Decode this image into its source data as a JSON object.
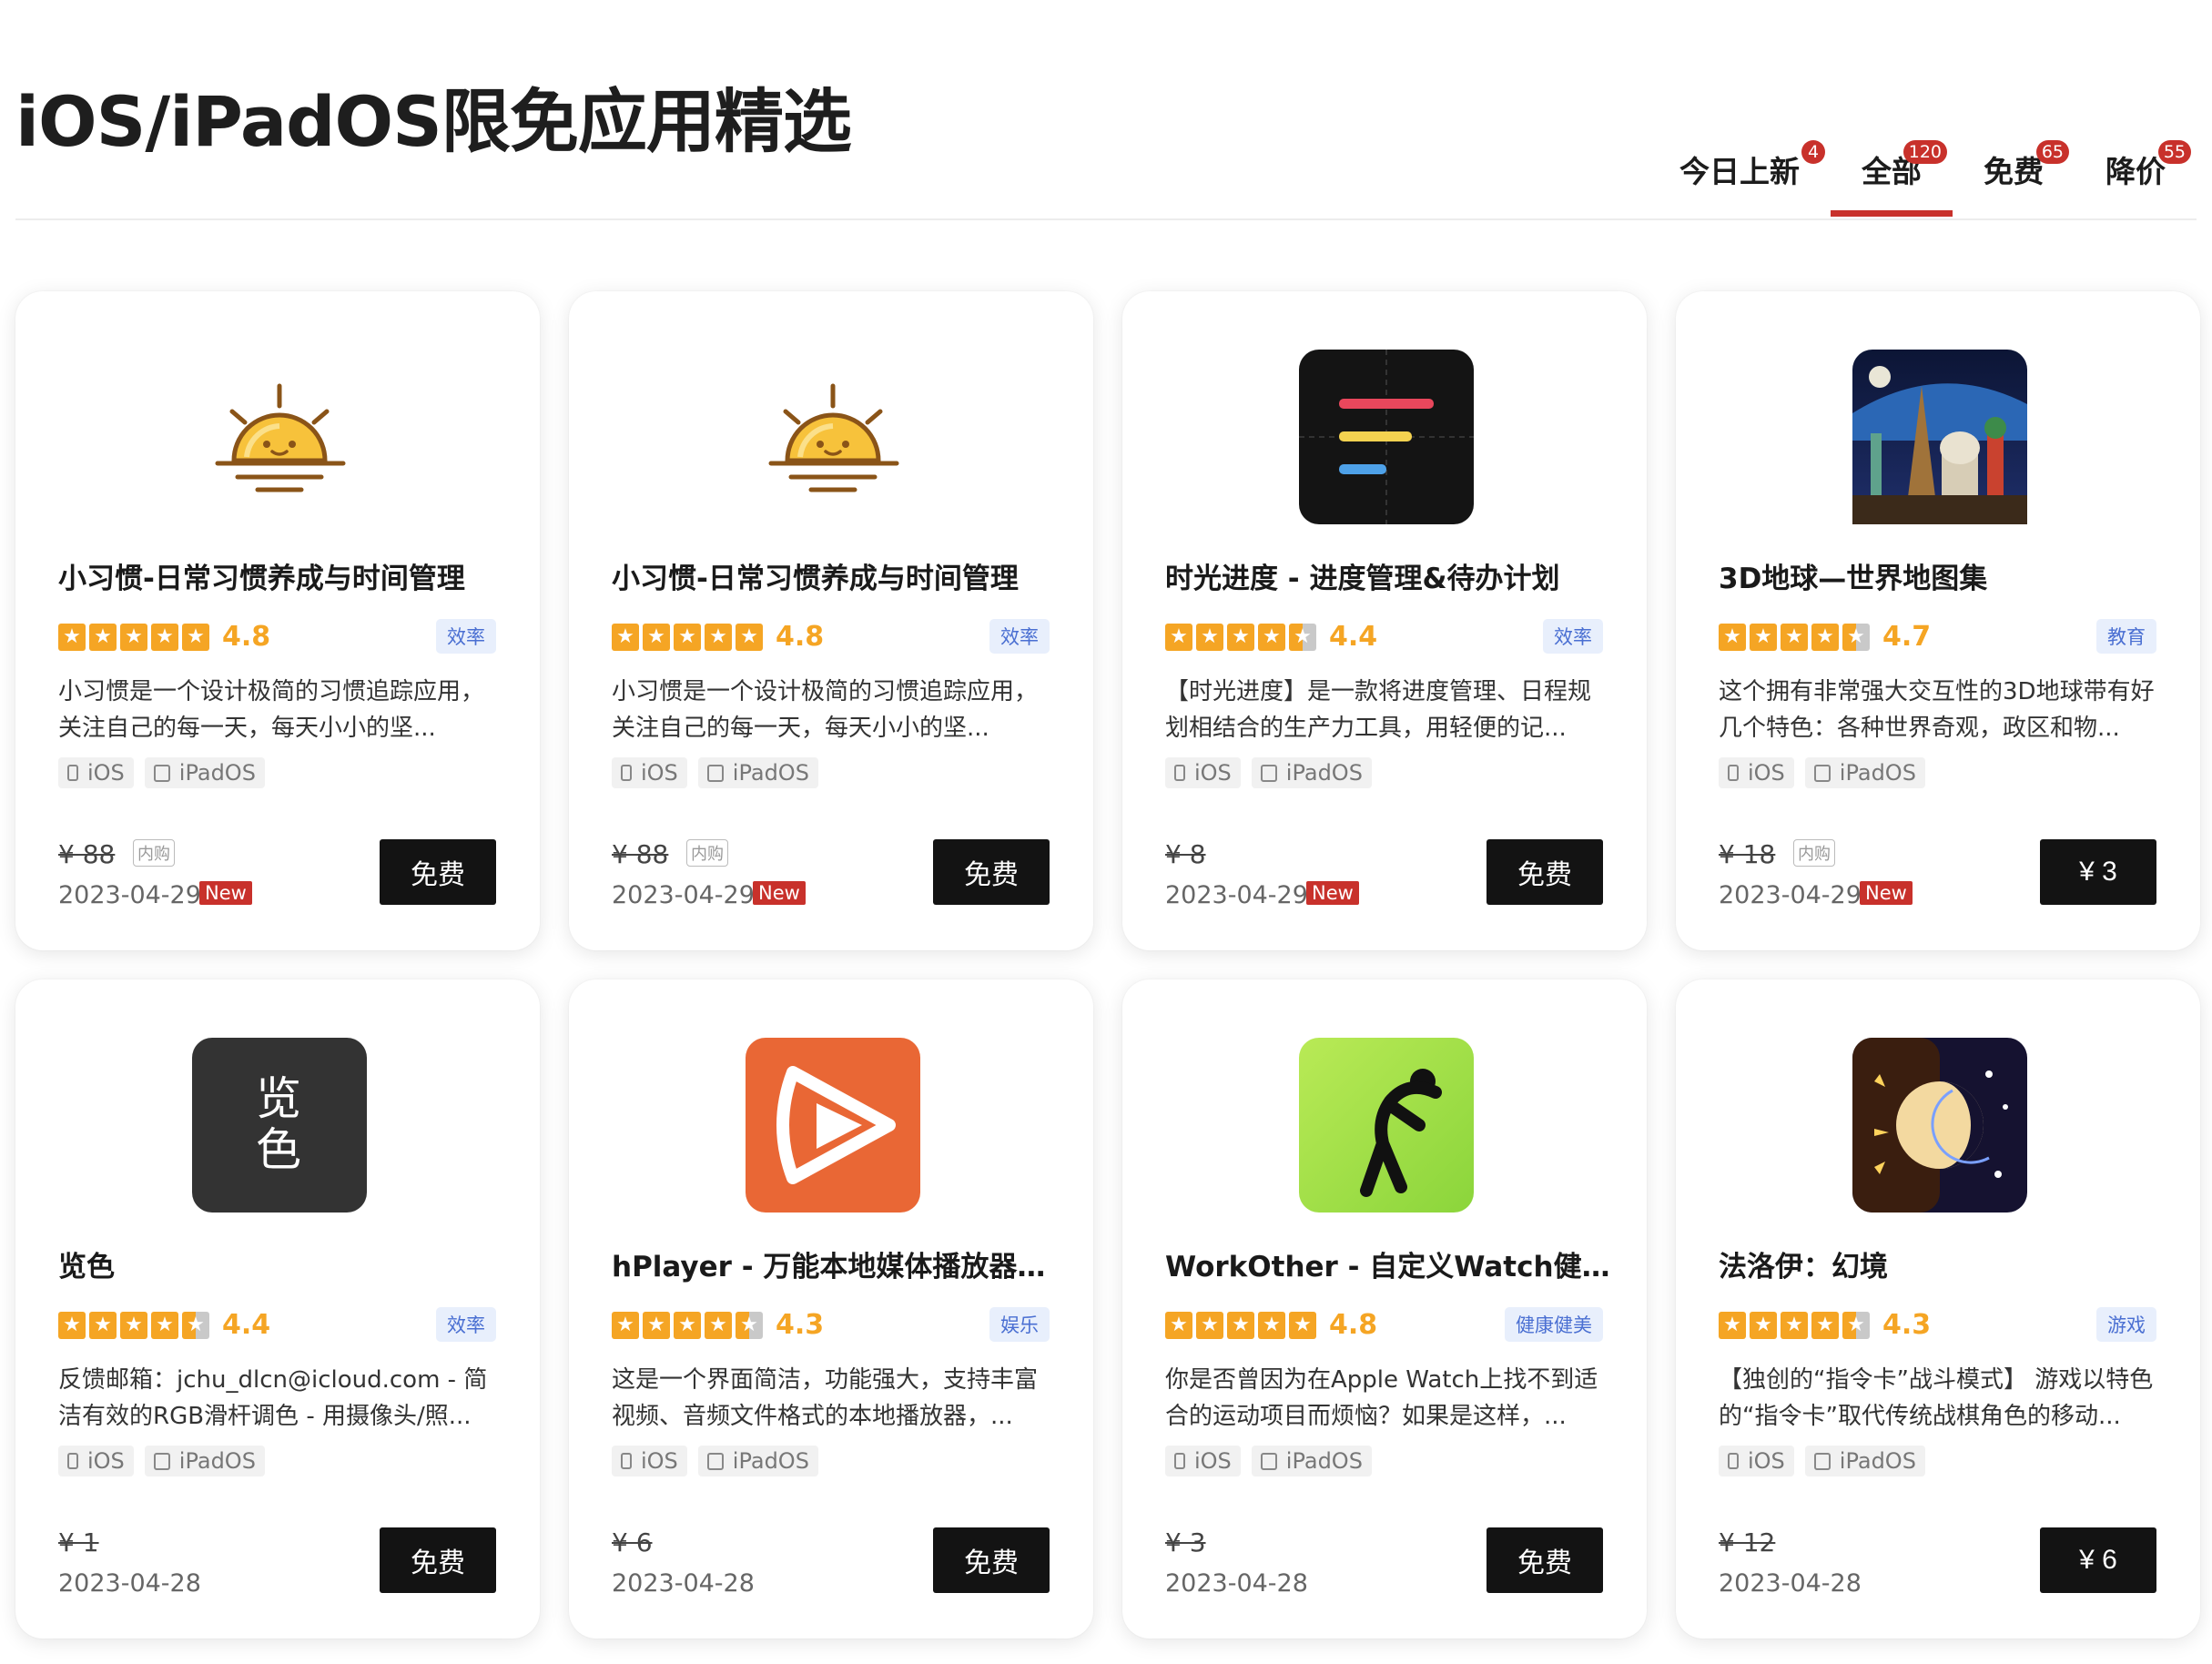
{
  "header": {
    "title": "iOS/iPadOS限免应用精选"
  },
  "tabs": [
    {
      "label": "今日上新",
      "count": "4",
      "active": false
    },
    {
      "label": "全部",
      "count": "120",
      "active": true
    },
    {
      "label": "免费",
      "count": "65",
      "active": false
    },
    {
      "label": "降价",
      "count": "55",
      "active": false
    }
  ],
  "platform_labels": {
    "ios": "iOS",
    "ipados": "iPadOS"
  },
  "iap_label": "内购",
  "new_label": "New",
  "apps": [
    {
      "name": "小习惯-日常习惯养成与时间管理",
      "rating": "4.8",
      "rating_value": 4.8,
      "category": "效率",
      "description": "小习惯是一个设计极简的习惯追踪应用，关注自己的每一天，每天小小的坚...",
      "original_price": "¥ 88",
      "iap": true,
      "date": "2023-04-29",
      "is_new": true,
      "price": "免费",
      "icon": "sunrise-icon"
    },
    {
      "name": "小习惯-日常习惯养成与时间管理",
      "rating": "4.8",
      "rating_value": 4.8,
      "category": "效率",
      "description": "小习惯是一个设计极简的习惯追踪应用，关注自己的每一天，每天小小的坚...",
      "original_price": "¥ 88",
      "iap": true,
      "date": "2023-04-29",
      "is_new": true,
      "price": "免费",
      "icon": "sunrise-icon"
    },
    {
      "name": "时光进度 - 进度管理&待办计划",
      "rating": "4.4",
      "rating_value": 4.4,
      "category": "效率",
      "description": "【时光进度】是一款将进度管理、日程规划相结合的生产力工具，用轻便的记...",
      "original_price": "¥ 8",
      "iap": false,
      "date": "2023-04-29",
      "is_new": true,
      "price": "免费",
      "icon": "progress-bars-icon"
    },
    {
      "name": "3D地球—世界地图集",
      "rating": "4.7",
      "rating_value": 4.7,
      "category": "教育",
      "description": "这个拥有非常强大交互性的3D地球带有好几个特色：各种世界奇观，政区和物...",
      "original_price": "¥ 18",
      "iap": true,
      "date": "2023-04-29",
      "is_new": true,
      "price": "¥ 3",
      "icon": "globe-landmarks-icon"
    },
    {
      "name": "览色",
      "rating": "4.4",
      "rating_value": 4.4,
      "category": "效率",
      "description": "反馈邮箱：jchu_dlcn@icloud.com - 简洁有效的RGB滑杆调色 - 用摄像头/照...",
      "original_price": "¥ 1",
      "iap": false,
      "date": "2023-04-28",
      "is_new": false,
      "price": "免费",
      "icon": "lanse-icon",
      "icon_text": "览色"
    },
    {
      "name": "hPlayer - 万能本地媒体播放器&...",
      "rating": "4.3",
      "rating_value": 4.3,
      "category": "娱乐",
      "description": "这是一个界面简洁，功能强大，支持丰富视频、音频文件格式的本地播放器，...",
      "original_price": "¥ 6",
      "iap": false,
      "date": "2023-04-28",
      "is_new": false,
      "price": "免费",
      "icon": "play-icon"
    },
    {
      "name": "WorkOther - 自定义Watch健身...",
      "rating": "4.8",
      "rating_value": 4.8,
      "category": "健康健美",
      "description": "你是否曾因为在Apple Watch上找不到适合的运动项目而烦恼？如果是这样，...",
      "original_price": "¥ 3",
      "iap": false,
      "date": "2023-04-28",
      "is_new": false,
      "price": "免费",
      "icon": "stretching-figure-icon"
    },
    {
      "name": "法洛伊：幻境",
      "rating": "4.3",
      "rating_value": 4.3,
      "category": "游戏",
      "description": "【独创的“指令卡”战斗模式】 游戏以特色的“指令卡”取代传统战棋角色的移动...",
      "original_price": "¥ 12",
      "iap": false,
      "date": "2023-04-28",
      "is_new": false,
      "price": "¥ 6",
      "icon": "sun-moon-icon"
    }
  ],
  "colors": {
    "accent": "#c8312b",
    "star": "#f5a524",
    "button": "#131313",
    "category_bg": "#e8effc",
    "category_text": "#4a6fd2"
  }
}
